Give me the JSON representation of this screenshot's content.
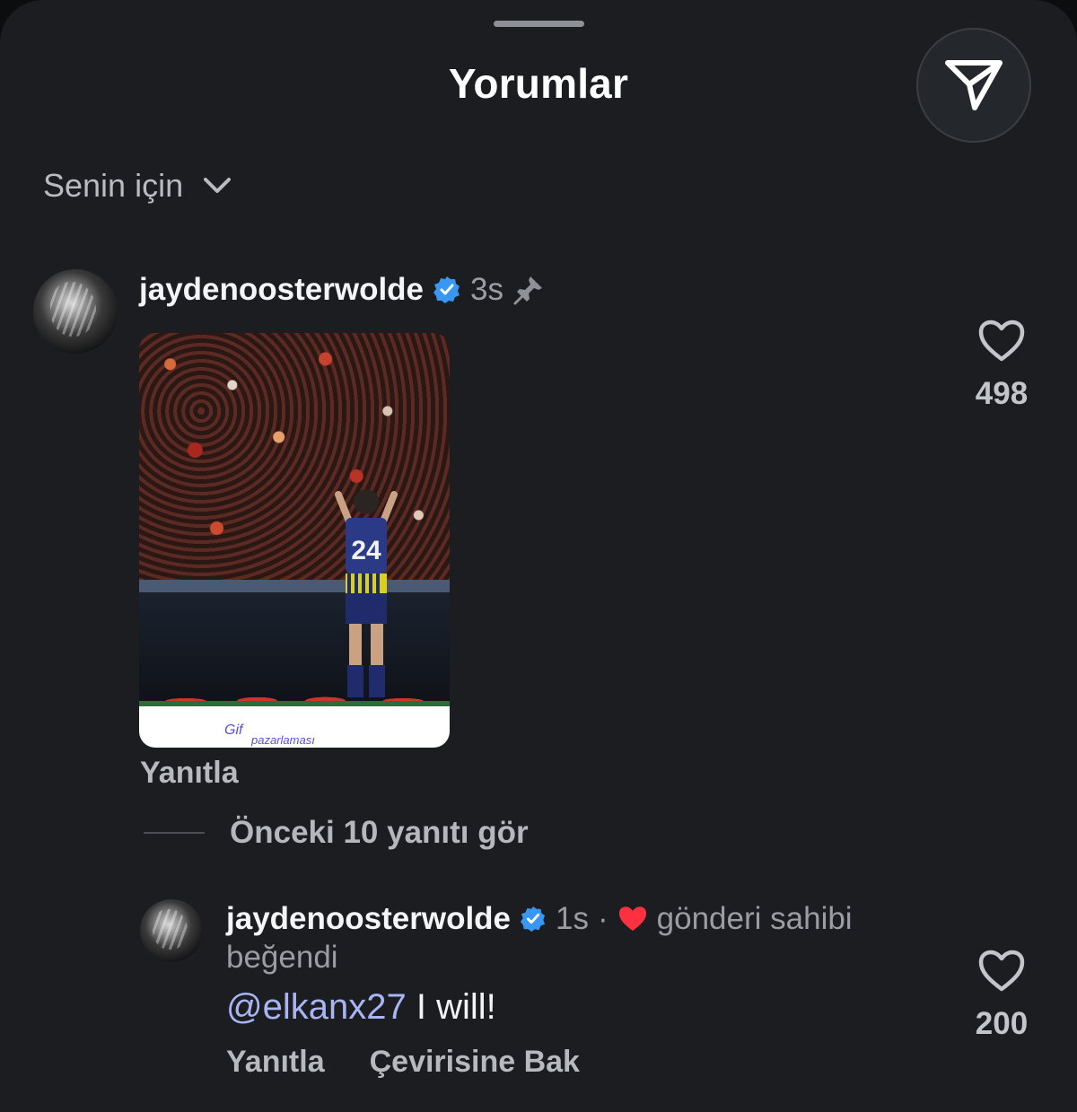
{
  "header": {
    "title": "Yorumlar"
  },
  "sort": {
    "label": "Senin için"
  },
  "comments": [
    {
      "username": "jaydenoosterwolde",
      "time": "3s",
      "pinned": true,
      "gif_watermark_line1": "Gif",
      "gif_watermark_line2": "pazarlaması",
      "gif_jersey_number": "24",
      "reply_label": "Yanıtla",
      "like_count": "498"
    }
  ],
  "view_previous_replies": "Önceki 10 yanıtı gör",
  "reply": {
    "username": "jaydenoosterwolde",
    "time": "1s",
    "separator": "·",
    "liked_by_owner_prefix": "gönderi sahibi",
    "liked_by_owner_suffix": "beğendi",
    "mention": "@elkanx27",
    "text": "I will!",
    "reply_label": "Yanıtla",
    "translate_label": "Çevirisine Bak",
    "like_count": "200"
  },
  "colors": {
    "sheet_background": "#1b1d21",
    "verified_badge": "#3897f0",
    "heart_red": "#ff3040",
    "mention": "#a9b4f2"
  }
}
